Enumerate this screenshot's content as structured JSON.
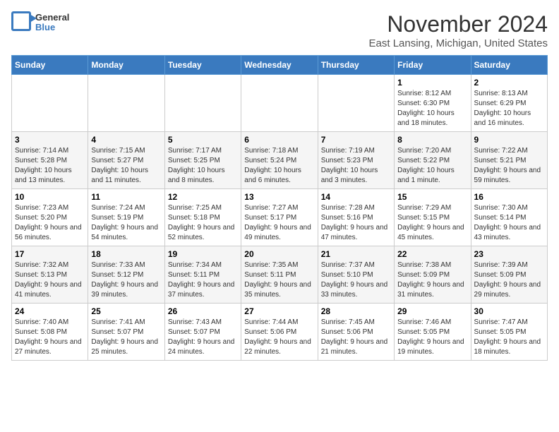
{
  "logo": {
    "line1": "General",
    "line2": "Blue"
  },
  "title": "November 2024",
  "location": "East Lansing, Michigan, United States",
  "days_of_week": [
    "Sunday",
    "Monday",
    "Tuesday",
    "Wednesday",
    "Thursday",
    "Friday",
    "Saturday"
  ],
  "weeks": [
    [
      {
        "day": "",
        "info": ""
      },
      {
        "day": "",
        "info": ""
      },
      {
        "day": "",
        "info": ""
      },
      {
        "day": "",
        "info": ""
      },
      {
        "day": "",
        "info": ""
      },
      {
        "day": "1",
        "info": "Sunrise: 8:12 AM\nSunset: 6:30 PM\nDaylight: 10 hours and 18 minutes."
      },
      {
        "day": "2",
        "info": "Sunrise: 8:13 AM\nSunset: 6:29 PM\nDaylight: 10 hours and 16 minutes."
      }
    ],
    [
      {
        "day": "3",
        "info": "Sunrise: 7:14 AM\nSunset: 5:28 PM\nDaylight: 10 hours and 13 minutes."
      },
      {
        "day": "4",
        "info": "Sunrise: 7:15 AM\nSunset: 5:27 PM\nDaylight: 10 hours and 11 minutes."
      },
      {
        "day": "5",
        "info": "Sunrise: 7:17 AM\nSunset: 5:25 PM\nDaylight: 10 hours and 8 minutes."
      },
      {
        "day": "6",
        "info": "Sunrise: 7:18 AM\nSunset: 5:24 PM\nDaylight: 10 hours and 6 minutes."
      },
      {
        "day": "7",
        "info": "Sunrise: 7:19 AM\nSunset: 5:23 PM\nDaylight: 10 hours and 3 minutes."
      },
      {
        "day": "8",
        "info": "Sunrise: 7:20 AM\nSunset: 5:22 PM\nDaylight: 10 hours and 1 minute."
      },
      {
        "day": "9",
        "info": "Sunrise: 7:22 AM\nSunset: 5:21 PM\nDaylight: 9 hours and 59 minutes."
      }
    ],
    [
      {
        "day": "10",
        "info": "Sunrise: 7:23 AM\nSunset: 5:20 PM\nDaylight: 9 hours and 56 minutes."
      },
      {
        "day": "11",
        "info": "Sunrise: 7:24 AM\nSunset: 5:19 PM\nDaylight: 9 hours and 54 minutes."
      },
      {
        "day": "12",
        "info": "Sunrise: 7:25 AM\nSunset: 5:18 PM\nDaylight: 9 hours and 52 minutes."
      },
      {
        "day": "13",
        "info": "Sunrise: 7:27 AM\nSunset: 5:17 PM\nDaylight: 9 hours and 49 minutes."
      },
      {
        "day": "14",
        "info": "Sunrise: 7:28 AM\nSunset: 5:16 PM\nDaylight: 9 hours and 47 minutes."
      },
      {
        "day": "15",
        "info": "Sunrise: 7:29 AM\nSunset: 5:15 PM\nDaylight: 9 hours and 45 minutes."
      },
      {
        "day": "16",
        "info": "Sunrise: 7:30 AM\nSunset: 5:14 PM\nDaylight: 9 hours and 43 minutes."
      }
    ],
    [
      {
        "day": "17",
        "info": "Sunrise: 7:32 AM\nSunset: 5:13 PM\nDaylight: 9 hours and 41 minutes."
      },
      {
        "day": "18",
        "info": "Sunrise: 7:33 AM\nSunset: 5:12 PM\nDaylight: 9 hours and 39 minutes."
      },
      {
        "day": "19",
        "info": "Sunrise: 7:34 AM\nSunset: 5:11 PM\nDaylight: 9 hours and 37 minutes."
      },
      {
        "day": "20",
        "info": "Sunrise: 7:35 AM\nSunset: 5:11 PM\nDaylight: 9 hours and 35 minutes."
      },
      {
        "day": "21",
        "info": "Sunrise: 7:37 AM\nSunset: 5:10 PM\nDaylight: 9 hours and 33 minutes."
      },
      {
        "day": "22",
        "info": "Sunrise: 7:38 AM\nSunset: 5:09 PM\nDaylight: 9 hours and 31 minutes."
      },
      {
        "day": "23",
        "info": "Sunrise: 7:39 AM\nSunset: 5:09 PM\nDaylight: 9 hours and 29 minutes."
      }
    ],
    [
      {
        "day": "24",
        "info": "Sunrise: 7:40 AM\nSunset: 5:08 PM\nDaylight: 9 hours and 27 minutes."
      },
      {
        "day": "25",
        "info": "Sunrise: 7:41 AM\nSunset: 5:07 PM\nDaylight: 9 hours and 25 minutes."
      },
      {
        "day": "26",
        "info": "Sunrise: 7:43 AM\nSunset: 5:07 PM\nDaylight: 9 hours and 24 minutes."
      },
      {
        "day": "27",
        "info": "Sunrise: 7:44 AM\nSunset: 5:06 PM\nDaylight: 9 hours and 22 minutes."
      },
      {
        "day": "28",
        "info": "Sunrise: 7:45 AM\nSunset: 5:06 PM\nDaylight: 9 hours and 21 minutes."
      },
      {
        "day": "29",
        "info": "Sunrise: 7:46 AM\nSunset: 5:05 PM\nDaylight: 9 hours and 19 minutes."
      },
      {
        "day": "30",
        "info": "Sunrise: 7:47 AM\nSunset: 5:05 PM\nDaylight: 9 hours and 18 minutes."
      }
    ]
  ]
}
